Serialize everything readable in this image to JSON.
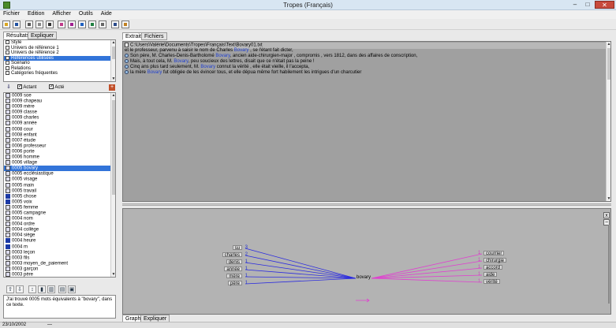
{
  "window": {
    "title": "Tropes (Français)",
    "min": "–",
    "max": "□",
    "close": "✕"
  },
  "menu": [
    "Fichier",
    "Edition",
    "Afficher",
    "Outils",
    "Aide"
  ],
  "left": {
    "tabs": [
      "Résultats",
      "Expliquer"
    ],
    "categories": [
      {
        "label": "Style",
        "icon": "list-icon"
      },
      {
        "label": "Univers de référence 1",
        "icon": "list-icon"
      },
      {
        "label": "Univers de référence 2",
        "icon": "list-icon"
      },
      {
        "label": "Références utilisées",
        "icon": "list-icon",
        "selected": true
      },
      {
        "label": "Scénario",
        "icon": "list-icon"
      },
      {
        "label": "Relations",
        "icon": "list-icon"
      },
      {
        "label": "Catégories fréquentes",
        "icon": "list-icon"
      }
    ],
    "options": {
      "actant": "Actant",
      "acte": "Acté",
      "check": "✓"
    },
    "words": [
      {
        "label": "0009 soe",
        "blue": false
      },
      {
        "label": "0009 chapeau",
        "blue": false
      },
      {
        "label": "0009 mère",
        "blue": false
      },
      {
        "label": "0009 classe",
        "blue": false
      },
      {
        "label": "0009 charles",
        "blue": false
      },
      {
        "label": "0009 année",
        "blue": false
      },
      {
        "label": "0008 cour",
        "blue": false
      },
      {
        "label": "0008 enfant",
        "blue": false
      },
      {
        "label": "0007 étude",
        "blue": false
      },
      {
        "label": "0006 professeur",
        "blue": false
      },
      {
        "label": "0006 porte",
        "blue": false
      },
      {
        "label": "0006 homme",
        "blue": false
      },
      {
        "label": "0006 village",
        "blue": false
      },
      {
        "label": "0005 bovary",
        "blue": false,
        "selected": true
      },
      {
        "label": "0005 ecclésiastique",
        "blue": false
      },
      {
        "label": "0005 visage",
        "blue": false
      },
      {
        "label": "0005 main",
        "blue": false
      },
      {
        "label": "0005 travail",
        "blue": false
      },
      {
        "label": "0005 chose",
        "blue": true
      },
      {
        "label": "0005 voix",
        "blue": true
      },
      {
        "label": "0005 femme",
        "blue": false
      },
      {
        "label": "0005 campagne",
        "blue": false
      },
      {
        "label": "0004 nom",
        "blue": false
      },
      {
        "label": "0004 ordre",
        "blue": false
      },
      {
        "label": "0004 collège",
        "blue": false
      },
      {
        "label": "0004 siège",
        "blue": false
      },
      {
        "label": "0004 heure",
        "blue": true
      },
      {
        "label": "0004 m",
        "blue": true
      },
      {
        "label": "0003 leçon",
        "blue": false
      },
      {
        "label": "0003 fils",
        "blue": false
      },
      {
        "label": "0003 moyen_de_paiement",
        "blue": false
      },
      {
        "label": "0003 garçon",
        "blue": false
      },
      {
        "label": "0003 père",
        "blue": false
      }
    ],
    "info": "J'ai trouvé 0005 mots équivalents à \"bovary\", dans ce texte."
  },
  "right": {
    "tabs": [
      "Extraits",
      "Fichiers"
    ],
    "filepath": "C:\\Users\\Valérie\\Documents\\Tropes\\Français\\Text\\Bovary01.txt",
    "lines": [
      {
        "bullet": false,
        "parts": [
          [
            "et le professeur, parvenu à saisir le nom de Charles ",
            false
          ],
          [
            "Bovary",
            true
          ],
          [
            " , se l'étant fait dicter,",
            false
          ]
        ]
      },
      {
        "bullet": true,
        "parts": [
          [
            "Son père, M. Charles-Denis-Bartholomé ",
            false
          ],
          [
            "Bovary",
            true
          ],
          [
            ", ancien aide-chirurgien-major , compromis , vers 1812, dans des affaires de conscription,",
            false
          ]
        ]
      },
      {
        "bullet": true,
        "parts": [
          [
            "Mais, à tout cela, M. ",
            false
          ],
          [
            "Bovary",
            true
          ],
          [
            ", peu soucieux des lettres, disait que ce n'était pas la peine !",
            false
          ]
        ]
      },
      {
        "bullet": true,
        "parts": [
          [
            "Cinq ans plus tard seulement, M. ",
            false
          ],
          [
            "Bovary",
            true
          ],
          [
            " connut la vérité , elle était vieille,  il l'accepta,",
            false
          ]
        ]
      },
      {
        "bullet": true,
        "parts": [
          [
            "la mère ",
            false
          ],
          [
            "Bovary",
            true
          ],
          [
            " fut obligée de les évincer tous,  et elle dépua même fort habilement les intrigues d'un charcutier",
            false
          ]
        ]
      }
    ],
    "graph": {
      "center": "bovary",
      "left_nodes": [
        {
          "label": "su",
          "count": "3"
        },
        {
          "label": "charles",
          "count": "2"
        },
        {
          "label": "denis",
          "count": "1"
        },
        {
          "label": "année",
          "count": "1"
        },
        {
          "label": "mère",
          "count": "1"
        },
        {
          "label": "père",
          "count": "1"
        }
      ],
      "right_nodes": [
        {
          "label": "courrier",
          "count": "1"
        },
        {
          "label": "chirurgie",
          "count": "1"
        },
        {
          "label": "accord",
          "count": "1"
        },
        {
          "label": "aide",
          "count": "1"
        },
        {
          "label": "vérité",
          "count": "1"
        }
      ],
      "colors": {
        "left": "#2a2ae0",
        "right": "#e040d0"
      }
    },
    "bottom_tabs": [
      "Graphe",
      "Expliquer"
    ],
    "side_close": "x",
    "side_minus": "−"
  },
  "status": {
    "left": "23/10/2002",
    "right": "—"
  }
}
